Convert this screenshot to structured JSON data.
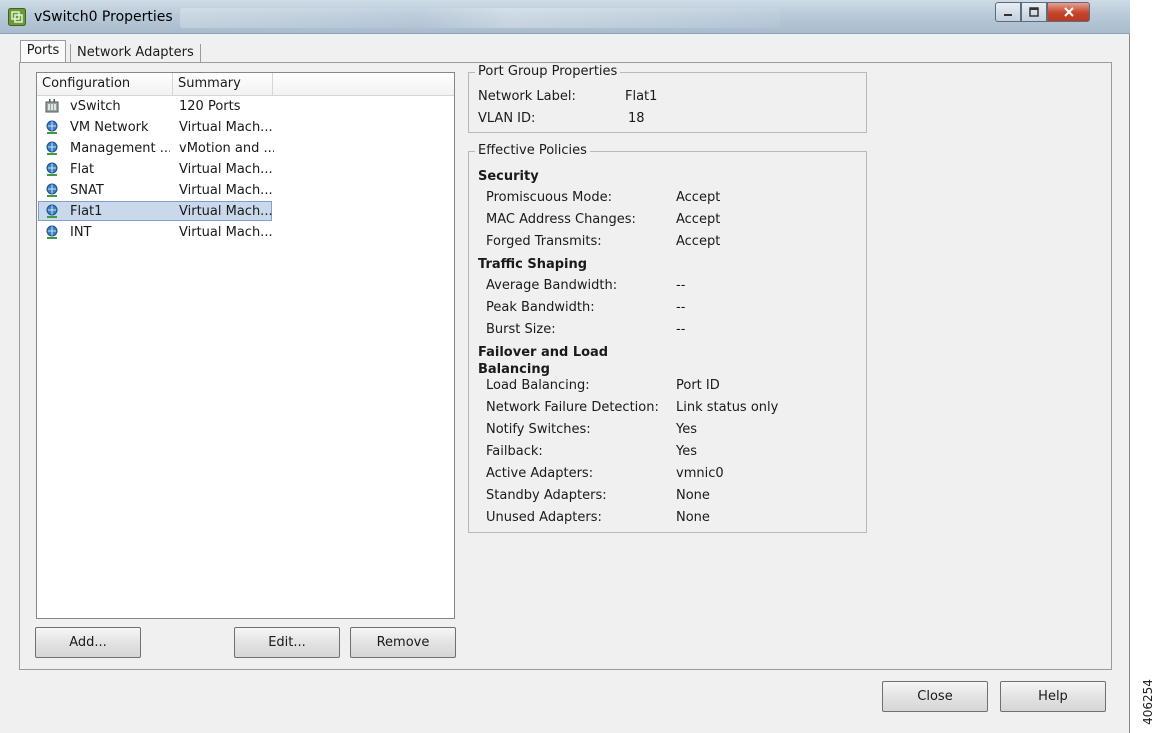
{
  "window": {
    "title": "vSwitch0 Properties"
  },
  "tabs": [
    {
      "label": "Ports"
    },
    {
      "label": "Network Adapters"
    }
  ],
  "list": {
    "columns": [
      "Configuration",
      "Summary",
      ""
    ],
    "rows": [
      {
        "icon": "vswitch-icon",
        "config": "vSwitch",
        "summary": "120 Ports"
      },
      {
        "icon": "port-group-icon",
        "config": "VM Network",
        "summary": "Virtual Mach..."
      },
      {
        "icon": "port-group-icon",
        "config": "Management ...",
        "summary": "vMotion and ..."
      },
      {
        "icon": "port-group-icon",
        "config": "Flat",
        "summary": "Virtual Mach..."
      },
      {
        "icon": "port-group-icon",
        "config": "SNAT",
        "summary": "Virtual Mach..."
      },
      {
        "icon": "port-group-icon",
        "config": "Flat1",
        "summary": "Virtual Mach...",
        "selected": true
      },
      {
        "icon": "port-group-icon",
        "config": "INT",
        "summary": "Virtual Mach..."
      }
    ]
  },
  "buttons": {
    "add": "Add...",
    "edit": "Edit...",
    "remove": "Remove",
    "close": "Close",
    "help": "Help"
  },
  "port_group": {
    "title": "Port Group Properties",
    "network_label_key": "Network Label:",
    "network_label_value": "Flat1",
    "vlan_key": "VLAN ID:",
    "vlan_value": "18"
  },
  "policies": {
    "title": "Effective Policies",
    "security": {
      "heading": "Security",
      "items": [
        {
          "key": "Promiscuous Mode:",
          "value": "Accept"
        },
        {
          "key": "MAC Address Changes:",
          "value": "Accept"
        },
        {
          "key": "Forged Transmits:",
          "value": "Accept"
        }
      ]
    },
    "traffic": {
      "heading": "Traffic Shaping",
      "items": [
        {
          "key": "Average Bandwidth:",
          "value": "--"
        },
        {
          "key": "Peak Bandwidth:",
          "value": "--"
        },
        {
          "key": "Burst Size:",
          "value": "--"
        }
      ]
    },
    "failover": {
      "heading_line1": "Failover and Load",
      "heading_line2": "Balancing",
      "items": [
        {
          "key": "Load Balancing:",
          "value": "Port ID"
        },
        {
          "key": "Network Failure Detection:",
          "value": "Link status only"
        },
        {
          "key": "Notify Switches:",
          "value": "Yes"
        },
        {
          "key": "Failback:",
          "value": "Yes"
        },
        {
          "key": "Active Adapters:",
          "value": "vmnic0"
        },
        {
          "key": "Standby Adapters:",
          "value": "None"
        },
        {
          "key": "Unused Adapters:",
          "value": "None"
        }
      ]
    }
  },
  "figure_number": "406254"
}
